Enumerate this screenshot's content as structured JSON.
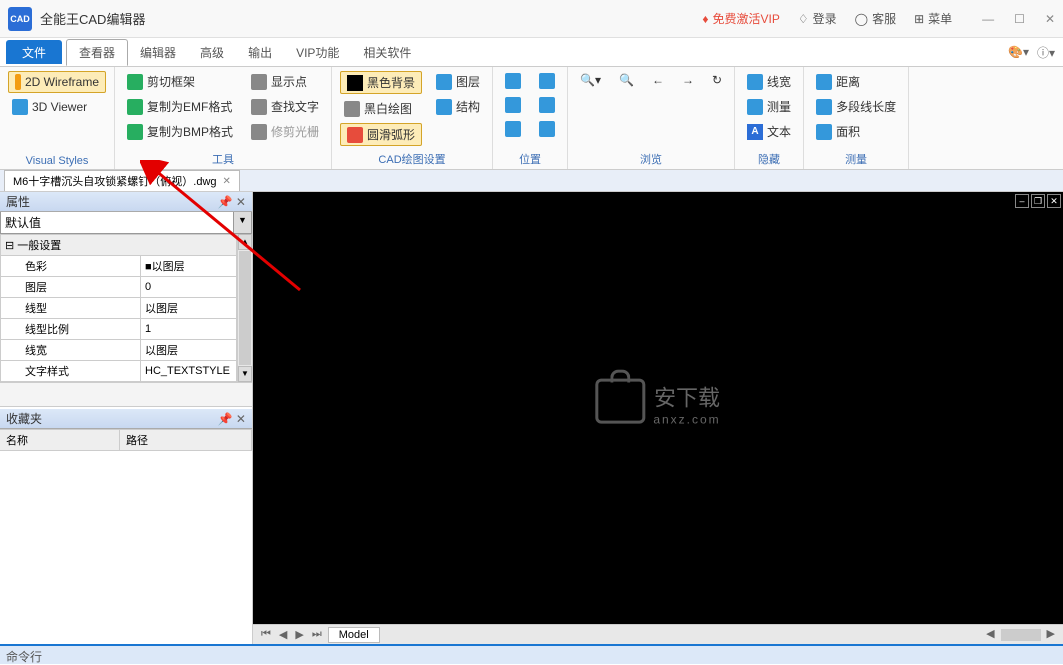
{
  "app": {
    "icon_text": "CAD",
    "title": "全能王CAD编辑器"
  },
  "titlebar": {
    "vip": "免费激活VIP",
    "login": "登录",
    "service": "客服",
    "menu": "菜单"
  },
  "menubar": {
    "file": "文件",
    "items": [
      "查看器",
      "编辑器",
      "高级",
      "输出",
      "VIP功能",
      "相关软件"
    ]
  },
  "ribbon": {
    "group1": {
      "label": "Visual Styles",
      "wireframe": "2D Wireframe",
      "viewer": "3D Viewer"
    },
    "group2": {
      "label": "工具",
      "items": [
        "剪切框架",
        "复制为EMF格式",
        "复制为BMP格式"
      ]
    },
    "group3": {
      "label": "",
      "items": [
        "显示点",
        "查找文字",
        "修剪光栅"
      ]
    },
    "group4": {
      "label": "CAD绘图设置",
      "bg": "黑色背景",
      "bw": "黑白绘图",
      "arc": "圆滑弧形",
      "layer": "图层",
      "struct": "结构"
    },
    "group5": {
      "label": "位置"
    },
    "group6": {
      "label": "浏览"
    },
    "group7": {
      "label": "隐藏",
      "linewidth": "线宽",
      "measure": "测量",
      "text": "文本"
    },
    "group8": {
      "label": "测量",
      "distance": "距离",
      "multiline": "多段线长度",
      "area": "面积"
    }
  },
  "document": {
    "tab_name": "M6十字槽沉头自攻锁紧螺钉（俯视）.dwg"
  },
  "sidebar": {
    "properties_title": "属性",
    "default_value": "默认值",
    "general_section": "一般设置",
    "rows": [
      {
        "label": "色彩",
        "value": "■以图层"
      },
      {
        "label": "图层",
        "value": "0"
      },
      {
        "label": "线型",
        "value": "以图层"
      },
      {
        "label": "线型比例",
        "value": "1"
      },
      {
        "label": "线宽",
        "value": "以图层"
      },
      {
        "label": "文字样式",
        "value": "HC_TEXTSTYLE"
      }
    ],
    "favorites_title": "收藏夹",
    "fav_col1": "名称",
    "fav_col2": "路径"
  },
  "canvas": {
    "watermark_text": "安下载",
    "watermark_sub": "anxz.com",
    "model_tab": "Model"
  },
  "command": {
    "label": "命令行"
  }
}
